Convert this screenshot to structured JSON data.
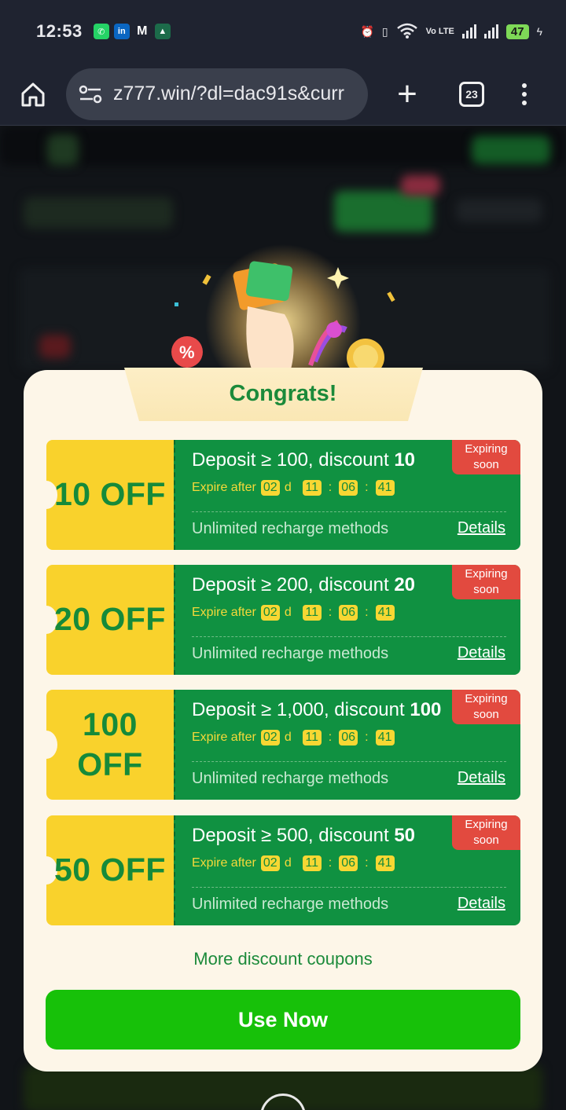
{
  "status_bar": {
    "time": "12:53",
    "network_label": "Vo LTE",
    "battery": "47"
  },
  "browser": {
    "url": "z777.win/?dl=dac91s&curr",
    "tab_count": "23"
  },
  "modal": {
    "title": "Congrats!",
    "more_link": "More discount coupons",
    "use_now": "Use Now"
  },
  "coupons": [
    {
      "amount_text": "10 OFF",
      "title_prefix": "Deposit ≥ 100, discount ",
      "discount": "10",
      "expire_label": "Expire after",
      "days": "02",
      "day_unit": "d",
      "hours": "11",
      "minutes": "06",
      "seconds": "41",
      "methods": "Unlimited recharge methods",
      "details": "Details",
      "badge": "Expiring soon"
    },
    {
      "amount_text": "20 OFF",
      "title_prefix": "Deposit ≥ 200, discount ",
      "discount": "20",
      "expire_label": "Expire after",
      "days": "02",
      "day_unit": "d",
      "hours": "11",
      "minutes": "06",
      "seconds": "41",
      "methods": "Unlimited recharge methods",
      "details": "Details",
      "badge": "Expiring soon"
    },
    {
      "amount_text": "100 OFF",
      "title_prefix": "Deposit ≥ 1,000, discount ",
      "discount": "100",
      "expire_label": "Expire after",
      "days": "02",
      "day_unit": "d",
      "hours": "11",
      "minutes": "06",
      "seconds": "41",
      "methods": "Unlimited recharge methods",
      "details": "Details",
      "badge": "Expiring soon"
    },
    {
      "amount_text": "50 OFF",
      "title_prefix": "Deposit ≥ 500, discount ",
      "discount": "50",
      "expire_label": "Expire after",
      "days": "02",
      "day_unit": "d",
      "hours": "11",
      "minutes": "06",
      "seconds": "41",
      "methods": "Unlimited recharge methods",
      "details": "Details",
      "badge": "Expiring soon"
    }
  ],
  "colors": {
    "coupon_green": "#109141",
    "coupon_yellow": "#f9d22c",
    "badge_red": "#e24a3f",
    "cta_green": "#17c109",
    "title_green": "#1b8a3a"
  }
}
